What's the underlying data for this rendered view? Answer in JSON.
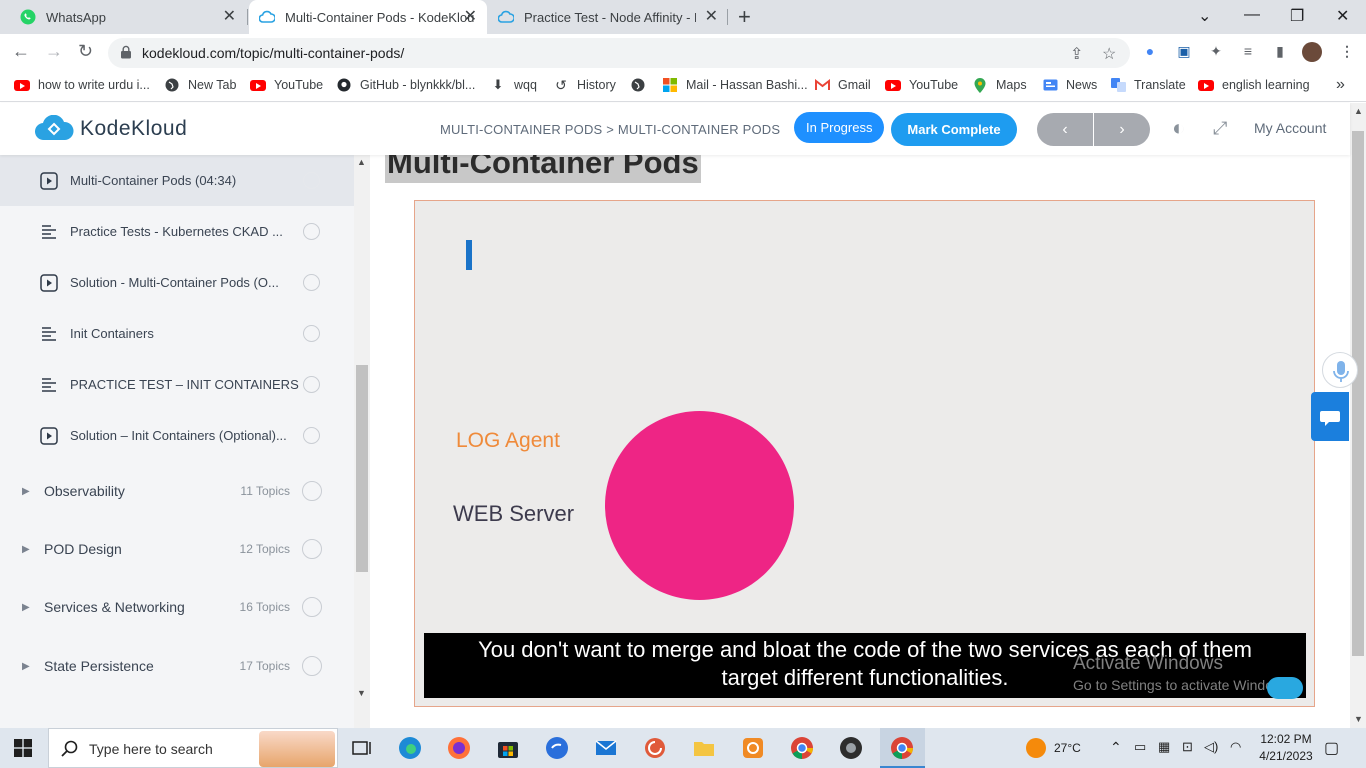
{
  "browser": {
    "tabs": [
      {
        "title": "WhatsApp",
        "icon": "whatsapp-icon",
        "active": false
      },
      {
        "title": "Multi-Container Pods - KodeKlou",
        "icon": "kodekloud-icon",
        "active": true
      },
      {
        "title": "Practice Test - Node Affinity - Ko",
        "icon": "kodekloud-icon",
        "active": false
      }
    ],
    "url": "kodekloud.com/topic/multi-container-pods/",
    "bookmarks": [
      {
        "label": "how to write urdu i...",
        "icon": "youtube-icon"
      },
      {
        "label": "New Tab",
        "icon": "globe-icon"
      },
      {
        "label": "YouTube",
        "icon": "youtube-icon"
      },
      {
        "label": "GitHub - blynkkk/bl...",
        "icon": "github-icon"
      },
      {
        "label": "wqq",
        "icon": "download-icon"
      },
      {
        "label": "History",
        "icon": "history-icon"
      },
      {
        "label": "",
        "icon": "globe-icon"
      },
      {
        "label": "Mail - Hassan Bashi...",
        "icon": "microsoft-icon"
      },
      {
        "label": "Gmail",
        "icon": "gmail-icon"
      },
      {
        "label": "YouTube",
        "icon": "youtube-icon"
      },
      {
        "label": "Maps",
        "icon": "maps-icon"
      },
      {
        "label": "News",
        "icon": "news-icon"
      },
      {
        "label": "Translate",
        "icon": "translate-icon"
      },
      {
        "label": "english learning",
        "icon": "youtube-icon"
      }
    ],
    "bookmarks_more": "»"
  },
  "site": {
    "brand": "KodeKloud",
    "breadcrumb": "MULTI-CONTAINER PODS > MULTI-CONTAINER PODS",
    "status_label": "In Progress",
    "complete_label": "Mark Complete",
    "prev_label": "‹",
    "next_label": "›",
    "account_label": "My Account"
  },
  "sidebar": {
    "lessons": [
      {
        "title": "Multi-Container Pods (04:34)",
        "type": "video",
        "current": true
      },
      {
        "title": "Practice Tests - Kubernetes CKAD ...",
        "type": "text",
        "current": false
      },
      {
        "title": "Solution - Multi-Container Pods (O...",
        "type": "video",
        "current": false
      },
      {
        "title": "Init Containers",
        "type": "text",
        "current": false
      },
      {
        "title": "PRACTICE TEST – INIT CONTAINERS",
        "type": "text",
        "current": false
      },
      {
        "title": "Solution – Init Containers (Optional)...",
        "type": "video",
        "current": false
      }
    ],
    "topics": [
      {
        "title": "Observability",
        "count": "11 Topics"
      },
      {
        "title": "POD Design",
        "count": "12 Topics"
      },
      {
        "title": "Services & Networking",
        "count": "16 Topics"
      },
      {
        "title": "State Persistence",
        "count": "17 Topics"
      }
    ]
  },
  "content": {
    "page_title": "Multi-Container Pods",
    "video": {
      "label_log_agent": "LOG Agent",
      "label_web_server": "WEB Server",
      "caption_line1": "You don't want to merge and bloat the code of the two services as each of them",
      "caption_line2": "target different functionalities.",
      "circle_color": "#ee2585"
    },
    "watermark_title": "Activate Windows",
    "watermark_sub": "Go to Settings to activate Windows."
  },
  "taskbar": {
    "search_placeholder": "Type here to search",
    "weather": "27°C",
    "time": "12:02 PM",
    "date": "4/21/2023"
  },
  "colors": {
    "accent": "#1e90ff",
    "complete": "#1e9cf0"
  }
}
